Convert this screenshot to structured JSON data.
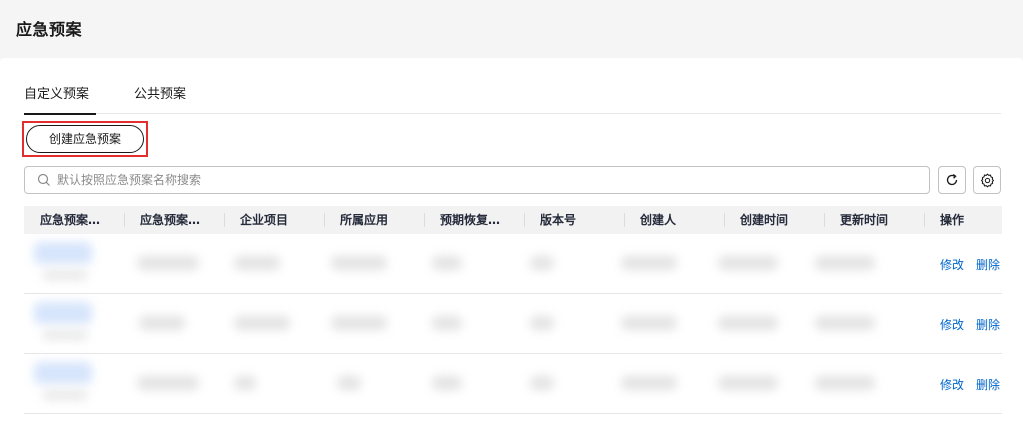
{
  "page": {
    "title": "应急预案"
  },
  "tabs": [
    {
      "label": "自定义预案",
      "active": true
    },
    {
      "label": "公共预案",
      "active": false
    }
  ],
  "toolbar": {
    "create_label": "创建应急预案"
  },
  "search": {
    "placeholder": "默认按照应急预案名称搜索",
    "value": ""
  },
  "icons": {
    "search": "search-icon",
    "refresh": "refresh-icon",
    "settings": "gear-icon"
  },
  "table": {
    "columns": [
      "应急预案…",
      "应急预案…",
      "企业项目",
      "所属应用",
      "预期恢复…",
      "版本号",
      "创建人",
      "创建时间",
      "更新时间",
      "操作"
    ],
    "rows": [
      {
        "edit_label": "修改",
        "delete_label": "删除"
      },
      {
        "edit_label": "修改",
        "delete_label": "删除"
      },
      {
        "edit_label": "修改",
        "delete_label": "删除"
      }
    ]
  },
  "colors": {
    "accent": "#0066cc",
    "highlight": "#e32e2e",
    "header_bg": "#f2f2f2"
  }
}
